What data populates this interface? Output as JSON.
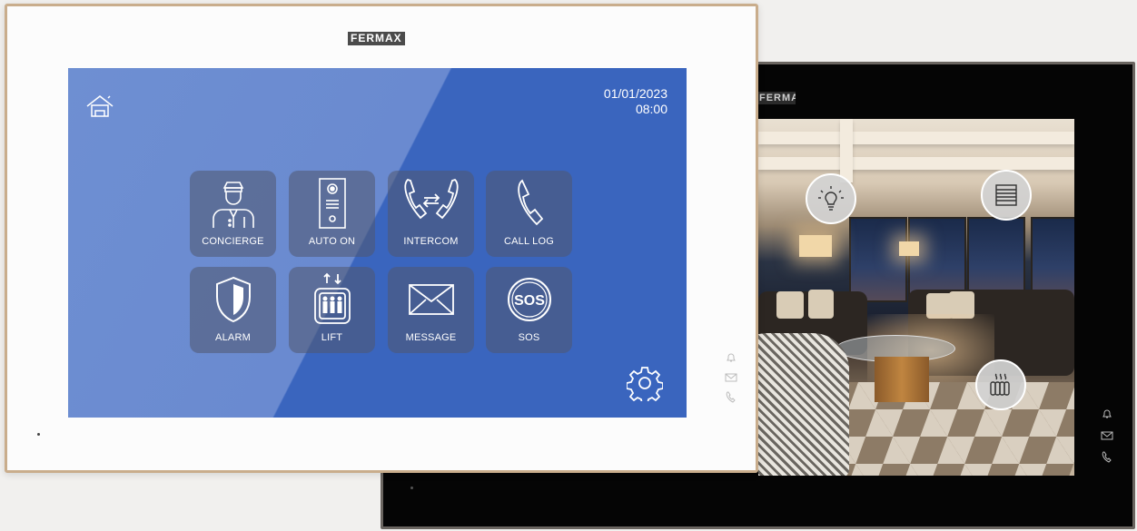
{
  "brand": {
    "front_logo": "FERMAX",
    "back_logo": "FERMAX"
  },
  "home_screen": {
    "date": "01/01/2023",
    "time": "08:00",
    "tiles": [
      {
        "label": "CONCIERGE",
        "icon": "concierge-icon"
      },
      {
        "label": "AUTO ON",
        "icon": "door-panel-icon"
      },
      {
        "label": "INTERCOM",
        "icon": "intercom-icon"
      },
      {
        "label": "CALL LOG",
        "icon": "phone-icon"
      },
      {
        "label": "ALARM",
        "icon": "shield-icon"
      },
      {
        "label": "LIFT",
        "icon": "lift-icon"
      },
      {
        "label": "MESSAGE",
        "icon": "envelope-icon"
      },
      {
        "label": "SOS",
        "icon": "sos-icon"
      }
    ]
  },
  "domotics_screen": {
    "controls": [
      "light-bulb-icon",
      "blinds-icon",
      "radiator-icon"
    ]
  },
  "colors": {
    "screen_blue": "#3a65be",
    "screen_blue_light": "#6e8fd2",
    "frame_gold": "#c9ad8c"
  }
}
